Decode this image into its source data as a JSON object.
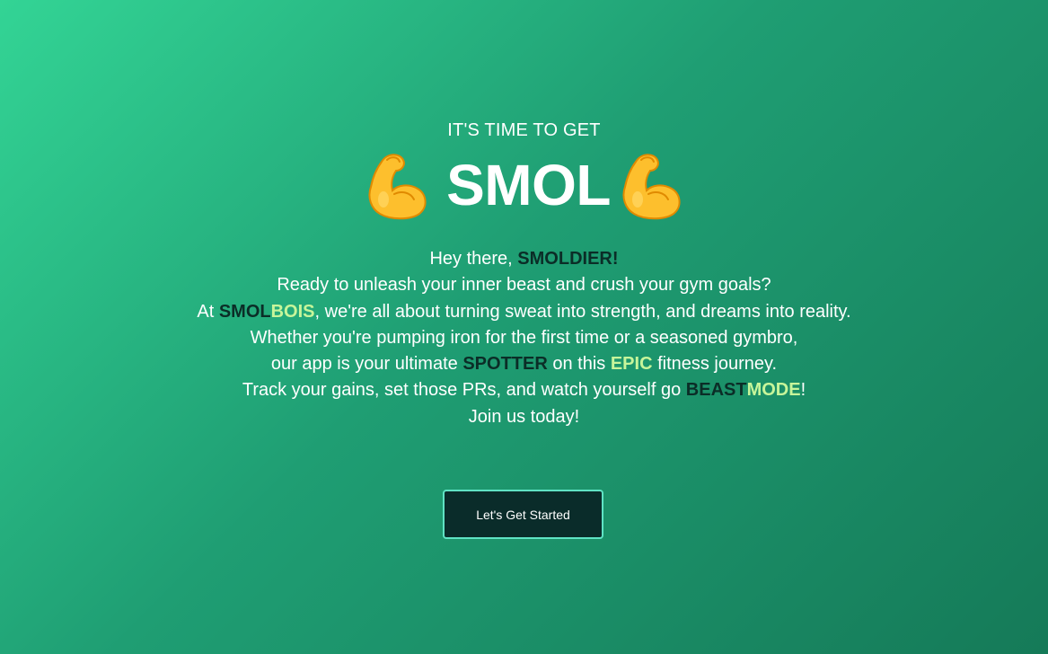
{
  "hero": {
    "kicker": "IT'S TIME TO GET",
    "title": "SMOL",
    "left_icon": "flexed-biceps-icon",
    "right_icon": "flexed-biceps-icon"
  },
  "copy": {
    "line1": {
      "pre": "Hey there, ",
      "highlight": "SMOLDIER!"
    },
    "line2": "Ready to unleash your inner beast and crush your gym goals?",
    "line3": {
      "pre": "At ",
      "brand_a": "SMOL",
      "brand_b": "BOIS",
      "post": ", we're all about turning sweat into strength, and dreams into reality."
    },
    "line4": "Whether you're pumping iron for the first time or a seasoned gymbro,",
    "line5": {
      "pre": "our app is your ultimate ",
      "highlight_a": "SPOTTER",
      "mid": " on this ",
      "highlight_b": "EPIC",
      "post": " fitness journey."
    },
    "line6": {
      "pre": "Track your gains, set those PRs, and watch yourself go ",
      "highlight_a": "BEAST",
      "highlight_b": "MODE",
      "post": "!"
    },
    "line7": "Join us today!"
  },
  "cta": {
    "label": "Let's Get Started"
  },
  "colors": {
    "background_start": "#33d495",
    "background_end": "#157a58",
    "dark_highlight": "#0b2d27",
    "lime_highlight": "#c7f59a",
    "button_bg": "#0a2c2a",
    "button_border": "#5fe3c4"
  }
}
